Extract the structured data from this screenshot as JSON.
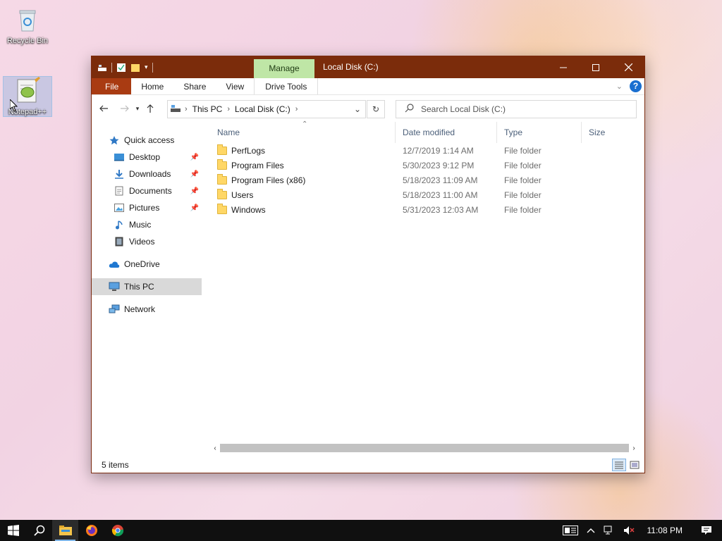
{
  "desktop": {
    "icons": [
      {
        "label": "Recycle Bin"
      },
      {
        "label": "Notepad++"
      }
    ]
  },
  "window": {
    "title": "Local Disk (C:)",
    "manage_tab": "Manage",
    "ribbon_tabs": [
      "File",
      "Home",
      "Share",
      "View",
      "Drive Tools"
    ],
    "help": "?"
  },
  "address": {
    "crumbs": [
      "This PC",
      "Local Disk (C:)"
    ],
    "search_placeholder": "Search Local Disk (C:)"
  },
  "nav": {
    "quick_access": "Quick access",
    "quick_items": [
      {
        "label": "Desktop",
        "icon": "desktop-icon",
        "pinned": true
      },
      {
        "label": "Downloads",
        "icon": "downloads-icon",
        "pinned": true
      },
      {
        "label": "Documents",
        "icon": "documents-icon",
        "pinned": true
      },
      {
        "label": "Pictures",
        "icon": "pictures-icon",
        "pinned": true
      },
      {
        "label": "Music",
        "icon": "music-icon",
        "pinned": false
      },
      {
        "label": "Videos",
        "icon": "videos-icon",
        "pinned": false
      }
    ],
    "onedrive": "OneDrive",
    "this_pc": "This PC",
    "network": "Network"
  },
  "files": {
    "columns": [
      "Name",
      "Date modified",
      "Type",
      "Size"
    ],
    "rows": [
      {
        "name": "PerfLogs",
        "date": "12/7/2019 1:14 AM",
        "type": "File folder",
        "size": ""
      },
      {
        "name": "Program Files",
        "date": "5/30/2023 9:12 PM",
        "type": "File folder",
        "size": ""
      },
      {
        "name": "Program Files (x86)",
        "date": "5/18/2023 11:09 AM",
        "type": "File folder",
        "size": ""
      },
      {
        "name": "Users",
        "date": "5/18/2023 11:00 AM",
        "type": "File folder",
        "size": ""
      },
      {
        "name": "Windows",
        "date": "5/31/2023 12:03 AM",
        "type": "File folder",
        "size": ""
      }
    ]
  },
  "status": {
    "item_count": "5 items"
  },
  "taskbar": {
    "time": "11:08 PM"
  },
  "colors": {
    "titlebar": "#7b2c0b",
    "file_tab": "#a93b12",
    "manage_tab": "#bfe6a6",
    "folder": "#ffd766",
    "taskbar": "#101010"
  }
}
